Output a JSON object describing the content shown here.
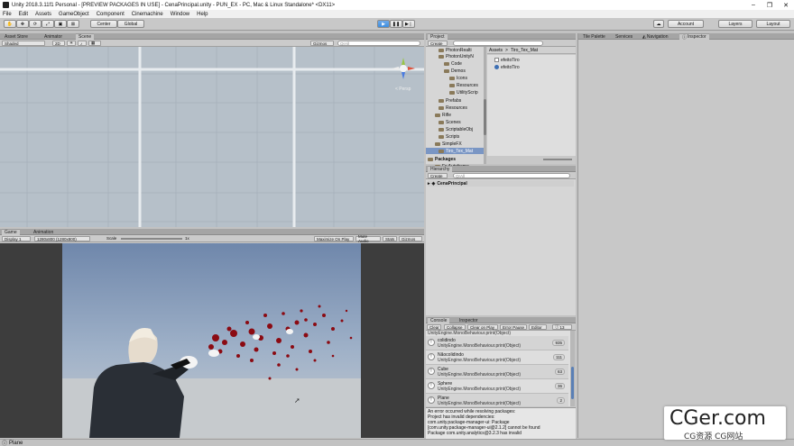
{
  "window": {
    "title": "Unity 2018.3.11f1 Personal - [PREVIEW PACKAGES IN USE] - CenaPrincipal.unity - PUN_EX - PC, Mac & Linux Standalone* <DX11>",
    "minimize": "–",
    "maximize": "❐",
    "close": "✕"
  },
  "menu": [
    "File",
    "Edit",
    "Assets",
    "GameObject",
    "Component",
    "Cinemachine",
    "Window",
    "Help"
  ],
  "toolbar": {
    "pivot_center": "Center",
    "pivot_global": "Global",
    "account": "Account",
    "layers": "Layers",
    "layout": "Layout"
  },
  "scene_panel": {
    "tabs": [
      "Asset Store",
      "Animator",
      "Scene"
    ],
    "shading": "Shaded",
    "mode_2d": "2D",
    "gizmos": "Gizmos",
    "search_placeholder": "QrAll",
    "axis_label": "< Persp"
  },
  "game_panel": {
    "tabs": [
      "Game",
      "Animation"
    ],
    "display": "Display 1",
    "resolution": "1280x800 (1280x800)",
    "scale_label": "Scale",
    "scale_value": "1x",
    "maximize": "Maximize On Play",
    "mute": "Mute Audio",
    "stats": "Stats",
    "gizmos": "Gizmos"
  },
  "project_panel": {
    "tab": "Project",
    "create": "Create",
    "breadcrumb": [
      "Assets",
      "Tiro_Tex_Mat"
    ],
    "tree": [
      "PhotonRealti",
      "PhotonUnityN",
      "Code",
      "Demos",
      "Icons",
      "Resources",
      "UtilityScrip",
      "Prefabs",
      "Resources",
      "Rifle",
      "Scenes",
      "ScriptableObj",
      "Scripts",
      "SimpleFX",
      "Tiro_Tex_Mat",
      "Packages",
      "Fx Autoframe"
    ],
    "files": [
      "efeitoTiro",
      "efeitoTiro"
    ]
  },
  "right_tabs": [
    "Tile Palette",
    "Services",
    "Navigation",
    "Inspector"
  ],
  "hierarchy_panel": {
    "tab": "Hierarchy",
    "create": "Create",
    "search_placeholder": "QrAll",
    "scene": "CenaPrincipal"
  },
  "console_panel": {
    "tabs": [
      "Console",
      "Inspector"
    ],
    "buttons": [
      "Clear",
      "Collapse",
      "Clear on Play",
      "Error Pause",
      "Editor"
    ],
    "info_count": "13",
    "top_line": "UnityEngine.MonoBehaviour.print(Object)",
    "rows": [
      {
        "title": "colidindo",
        "detail": "UnityEngine.MonoBehaviour.print(Object)",
        "count": "935"
      },
      {
        "title": "Nãocolidindo",
        "detail": "UnityEngine.MonoBehaviour.print(Object)",
        "count": "111"
      },
      {
        "title": "Cube",
        "detail": "UnityEngine.MonoBehaviour.print(Object)",
        "count": "63"
      },
      {
        "title": "Sphere",
        "detail": "UnityEngine.MonoBehaviour.print(Object)",
        "count": "36"
      },
      {
        "title": "Plane",
        "detail": "UnityEngine.MonoBehaviour.print(Object)",
        "count": "2"
      }
    ],
    "error_lines": [
      "An error occurred while resolving packages:",
      "  Project has invalid dependencies:",
      "    com.unity.package-manager-ui: Package",
      "[com.unity.package-manager-ui@2.1.2] cannot be found",
      "    Package com.unity.analytics@3.2.3 has invalid"
    ]
  },
  "status_bar": {
    "text": "Plane"
  },
  "watermark": {
    "brand": "CGer.com",
    "sub": "CG资源 CG网站"
  },
  "colors": {
    "accent_blue": "#3d8ee0",
    "sky_top": "#6f87ab",
    "ground": "#c8ccd0",
    "blood": "#8b0a12"
  }
}
